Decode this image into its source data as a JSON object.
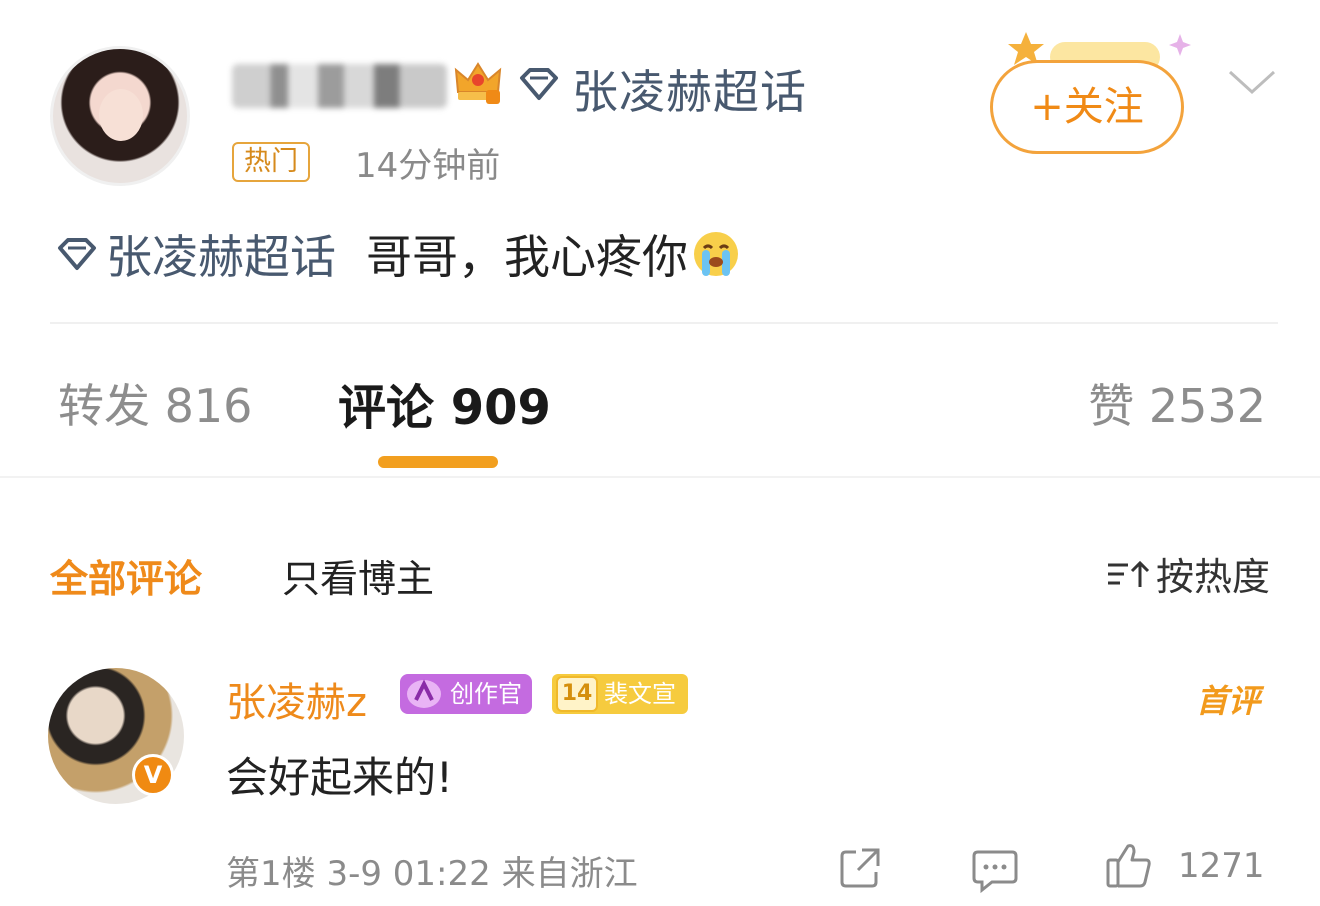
{
  "post": {
    "topic": "张凌赫超话",
    "hot_label": "热门",
    "time": "14分钟前",
    "follow_label": "+关注",
    "body_topic": "张凌赫超话",
    "body_text": "哥哥，我心疼你"
  },
  "stats": {
    "reposts": "转发 816",
    "comments": "评论 909",
    "likes": "赞 2532"
  },
  "filters": {
    "all": "全部评论",
    "author_only": "只看博主",
    "sort": "按热度"
  },
  "comment": {
    "author": "张凌赫z",
    "creator_badge": "创作官",
    "fan_level": "14",
    "fan_badge": "裴文宣",
    "first_badge": "首评",
    "text": "会好起来的!",
    "meta": "第1楼 3-9 01:22 来自浙江",
    "like_count": "1271",
    "verified_mark": "V"
  },
  "colors": {
    "accent": "#f29f1f",
    "topic": "#48596f",
    "creator": "#c46be0"
  }
}
